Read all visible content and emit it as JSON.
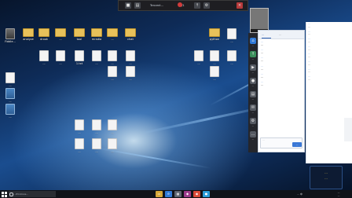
{
  "colors": {
    "accent": "#2d5fb0",
    "taskbar": "#101319",
    "record": "#d23b3b",
    "badge_text": "#ffd84a"
  },
  "desktop_icons": [
    {
      "label": "Fiddle...",
      "type": "app"
    },
    {
      "label": "analyze",
      "type": "folder"
    },
    {
      "label": "drook",
      "type": "folder"
    },
    {
      "label": "...",
      "type": "folder"
    },
    {
      "label": "tool",
      "type": "folder"
    },
    {
      "label": "mradia",
      "type": "folder"
    },
    {
      "label": "...",
      "type": "folder"
    },
    {
      "label": "chat",
      "type": "folder"
    },
    {
      "label": "...",
      "type": "doc"
    },
    {
      "label": "...",
      "type": "doc"
    },
    {
      "label": "1.txt",
      "type": "doc"
    },
    {
      "label": "...",
      "type": "doc"
    },
    {
      "label": "...",
      "type": "doc"
    },
    {
      "label": "...",
      "type": "doc"
    },
    {
      "label": "...",
      "type": "doc"
    },
    {
      "label": "...",
      "type": "doc"
    },
    {
      "label": "...",
      "type": "doc"
    },
    {
      "label": "...",
      "type": "img"
    },
    {
      "label": "...",
      "type": "img"
    },
    {
      "label": "...",
      "type": "doc"
    },
    {
      "label": "...",
      "type": "doc"
    },
    {
      "label": "...",
      "type": "doc"
    },
    {
      "label": "...",
      "type": "doc"
    },
    {
      "label": "...",
      "type": "doc"
    },
    {
      "label": "...",
      "type": "doc"
    },
    {
      "label": "python",
      "type": "folder"
    },
    {
      "label": "...",
      "type": "doc"
    },
    {
      "label": "...",
      "type": "doc"
    },
    {
      "label": "...",
      "type": "doc"
    },
    {
      "label": "...",
      "type": "doc"
    },
    {
      "label": "...",
      "type": "doc"
    }
  ],
  "topbar": {
    "title": "Tencent...",
    "counter": "1/1",
    "icons": [
      "camera-icon",
      "chat-icon",
      "share-icon",
      "settings-icon",
      "close-icon"
    ]
  },
  "pip": {
    "caption": "..."
  },
  "icon_bar": [
    {
      "icon": "home-icon",
      "label": "..."
    },
    {
      "icon": "share-icon",
      "label": "..."
    },
    {
      "icon": "video-icon",
      "label": "..."
    },
    {
      "icon": "mic-icon",
      "label": "..."
    },
    {
      "icon": "file-icon",
      "label": "..."
    },
    {
      "icon": "chat-icon",
      "label": "..."
    },
    {
      "icon": "settings-icon",
      "label": "..."
    },
    {
      "icon": "more-icon",
      "label": "..."
    }
  ],
  "panel": {
    "tabs": [
      "...",
      "..."
    ],
    "messages": [
      {
        "name": "...",
        "text": "..."
      },
      {
        "name": "...",
        "text": "..."
      },
      {
        "name": "...",
        "text": "..."
      },
      {
        "name": "...",
        "text": "..."
      },
      {
        "name": "...",
        "text": "..."
      },
      {
        "name": "...",
        "text": "..."
      }
    ],
    "input_placeholder": "...",
    "send_label": "..."
  },
  "chat": {
    "messages": [
      {
        "name": "...",
        "text": "..."
      },
      {
        "name": "...",
        "text": "..."
      },
      {
        "name": "...",
        "text": "..."
      },
      {
        "name": "...",
        "text": "..."
      },
      {
        "name": "...",
        "text": "..."
      },
      {
        "name": "...",
        "text": "..."
      },
      {
        "name": "...",
        "text": "..."
      },
      {
        "name": "...",
        "text": "..."
      }
    ]
  },
  "badge": {
    "line1": "...",
    "line2": "..."
  },
  "taskbar": {
    "search_placeholder": "...Windows...",
    "apps": [
      "file-explorer-icon",
      "edge-icon",
      "store-icon",
      "app-icon",
      "chrome-icon",
      "qq-icon"
    ],
    "tray_text": "... 中",
    "time": "...",
    "date": "..."
  }
}
